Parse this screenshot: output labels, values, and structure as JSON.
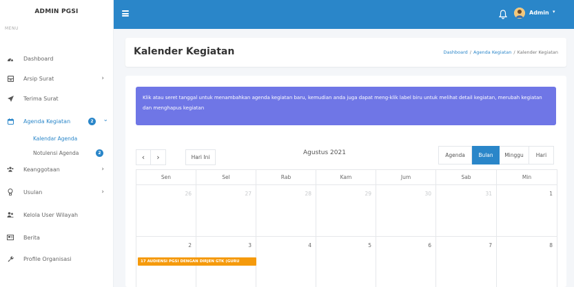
{
  "sidebar": {
    "brand": "ADMIN PGSI",
    "menu_header": "MENU",
    "items": [
      {
        "label": "Dashboard",
        "icon": "dashboard-icon"
      },
      {
        "label": "Arsip Surat",
        "icon": "archive-icon",
        "chevron": "›"
      },
      {
        "label": "Terima Surat",
        "icon": "paper-plane-icon"
      },
      {
        "label": "Agenda Kegiatan",
        "icon": "calendar-icon",
        "badge": "2",
        "chevron": "⌄"
      },
      {
        "label": "Keanggotaan",
        "icon": "users-icon",
        "chevron": "›"
      },
      {
        "label": "Usulan",
        "icon": "lightbulb-icon",
        "chevron": "›"
      },
      {
        "label": "Kelola User Wilayah",
        "icon": "user-group-icon"
      },
      {
        "label": "Berita",
        "icon": "newspaper-icon"
      },
      {
        "label": "Profile Organisasi",
        "icon": "wrench-icon"
      }
    ],
    "subitems": [
      {
        "label": "Kalendar Agenda"
      },
      {
        "label": "Notulensi Agenda",
        "badge": "2"
      }
    ]
  },
  "topbar": {
    "user_name": "Admin",
    "caret": "▾",
    "accent_color": "#2a86c9"
  },
  "header": {
    "title": "Kalender Kegiatan",
    "breadcrumb": [
      "Dashboard",
      "Agenda Kegiatan",
      "Kalender Kegiatan"
    ],
    "separator": "/"
  },
  "alert": {
    "text": "Klik atau seret tanggal untuk menambahkan agenda kegiatan baru, kemudian anda juga dapat meng-klik label biru untuk melihat detail kegiatan, merubah kegiatan dan menghapus kegiatan",
    "color": "#6f76e6"
  },
  "calendar": {
    "prev_label": "‹",
    "next_label": "›",
    "today_label": "Hari Ini",
    "month_title": "Agustus 2021",
    "views": [
      "Agenda",
      "Bulan",
      "Minggu",
      "Hari"
    ],
    "active_view": "Bulan",
    "weekdays": [
      "Sen",
      "Sel",
      "Rab",
      "Kam",
      "Jum",
      "Sab",
      "Min"
    ],
    "weeks": [
      [
        {
          "day": "26",
          "other": true
        },
        {
          "day": "27",
          "other": true
        },
        {
          "day": "28",
          "other": true
        },
        {
          "day": "29",
          "other": true
        },
        {
          "day": "30",
          "other": true
        },
        {
          "day": "31",
          "other": true
        },
        {
          "day": "1",
          "other": false
        }
      ],
      [
        {
          "day": "2",
          "other": false
        },
        {
          "day": "3",
          "other": false
        },
        {
          "day": "4",
          "other": false
        },
        {
          "day": "5",
          "other": false
        },
        {
          "day": "6",
          "other": false
        },
        {
          "day": "7",
          "other": false
        },
        {
          "day": "8",
          "other": false
        }
      ]
    ],
    "events": [
      {
        "label": "17 AUDIENSI PGSI DENGAN DIRJEN GTK (GURU",
        "color": "#f59a0c"
      }
    ]
  }
}
